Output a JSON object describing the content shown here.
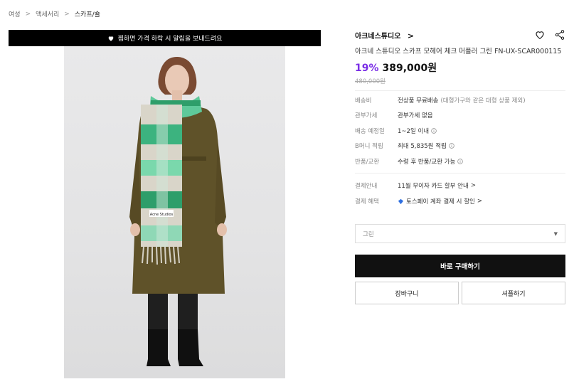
{
  "breadcrumb": [
    "여성",
    "액세서리",
    "스카프/숄"
  ],
  "banner": {
    "text": "찜하면 가격 하락 시 알림을 보내드려요"
  },
  "photo": {
    "scarf_label": "Acne Studios"
  },
  "product": {
    "brand": "아크네스튜디오",
    "name": "아크네 스튜디오 스카프 모헤어 체크 머플러 그린 FN-UX-SCAR000115",
    "discount": "19%",
    "price": "389,000원",
    "original_price": "480,000원"
  },
  "info": [
    {
      "label": "배송비",
      "value": "전상품 무료배송",
      "sub": "(대형가구와 같은 대형 상품 제외)"
    },
    {
      "label": "관부가세",
      "value": "관부가세 없음"
    },
    {
      "label": "배송 예정일",
      "value": "1~2일 이내"
    },
    {
      "label": "B머니 적립",
      "value": "최대 5,835원 적립"
    },
    {
      "label": "반품/교환",
      "value": "수령 후 반품/교환 가능"
    }
  ],
  "payment": [
    {
      "label": "결제안내",
      "value": "11월 무이자 카드 할부 안내"
    },
    {
      "label": "결제 혜택",
      "value": "토스페이 계좌 결제 시 할인"
    }
  ],
  "option_select": {
    "value": "그린"
  },
  "actions": {
    "buy": "바로 구매하기",
    "cart": "장바구니",
    "share": "셔플하기"
  },
  "colors": {
    "discount": "#7a2ee6",
    "banner_bg": "#000000",
    "buy_bg": "#111111"
  }
}
